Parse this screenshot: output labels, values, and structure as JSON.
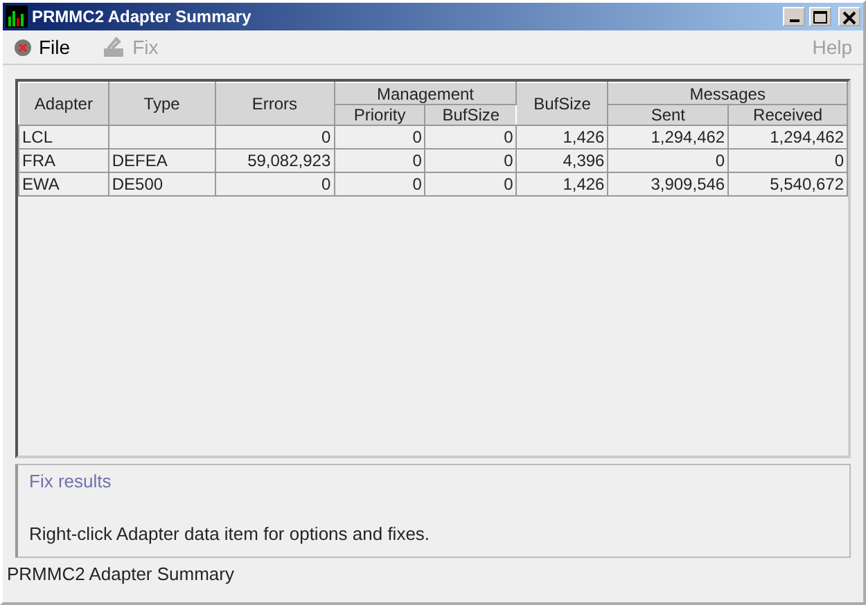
{
  "window": {
    "title": "PRMMC2 Adapter Summary"
  },
  "menu": [
    {
      "label": "File",
      "disabled": false
    },
    {
      "label": "Fix",
      "disabled": true
    },
    {
      "label": "Help",
      "disabled": true
    }
  ],
  "table": {
    "groups": [
      {
        "label": "Adapter"
      },
      {
        "label": "Type"
      },
      {
        "label": "Errors"
      },
      {
        "label": "Management",
        "columns": [
          "Priority",
          "BufSize"
        ]
      },
      {
        "label": "BufSize"
      },
      {
        "label": "Messages",
        "columns": [
          "Sent",
          "Received"
        ]
      }
    ],
    "rows": [
      [
        "LCL",
        "",
        "0",
        "0",
        "0",
        "1,426",
        "1,294,462",
        "1,294,462"
      ],
      [
        "FRA",
        "DEFEA",
        "59,082,923",
        "0",
        "0",
        "4,396",
        "0",
        "0"
      ],
      [
        "EWA",
        "DE500",
        "0",
        "0",
        "0",
        "1,426",
        "3,909,546",
        "5,540,672"
      ]
    ]
  },
  "fix_panel": {
    "title": "Fix results",
    "message": "Right-click Adapter data item for options and fixes."
  },
  "status_bar": "PRMMC2 Adapter Summary"
}
